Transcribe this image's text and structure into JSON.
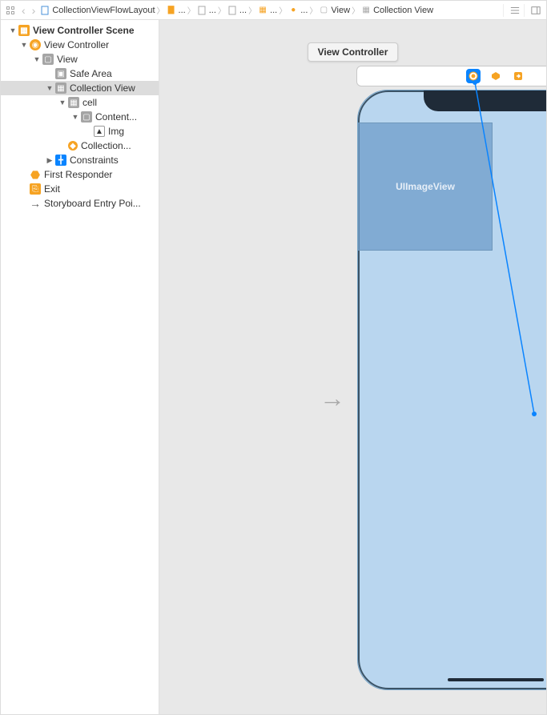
{
  "breadcrumb": {
    "root": "CollectionViewFlowLayout",
    "items": [
      {
        "label": "...",
        "icon": "folder"
      },
      {
        "label": "...",
        "icon": "storyboard"
      },
      {
        "label": "...",
        "icon": "storyboard"
      },
      {
        "label": "...",
        "icon": "scene"
      },
      {
        "label": "...",
        "icon": "vc"
      },
      {
        "label": "View",
        "icon": "view"
      },
      {
        "label": "Collection View",
        "icon": "grid"
      }
    ]
  },
  "outline": {
    "scene": "View Controller Scene",
    "vc": "View Controller",
    "view": "View",
    "safe": "Safe Area",
    "collectionView": "Collection View",
    "cell": "cell",
    "content": "Content...",
    "img": "Img",
    "flowLayout": "Collection...",
    "constraints": "Constraints",
    "firstResponder": "First Responder",
    "exit": "Exit",
    "entryPoint": "Storyboard Entry Poi..."
  },
  "canvas": {
    "tooltip": "View Controller",
    "cellPlaceholder": "UIImageView"
  }
}
